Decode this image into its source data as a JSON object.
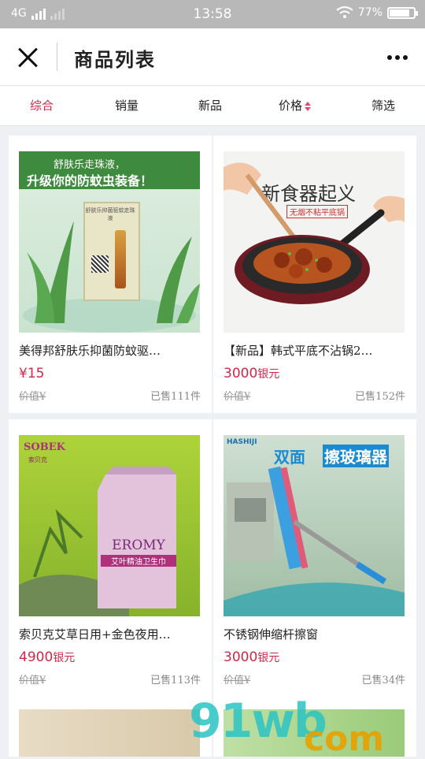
{
  "status_bar": {
    "network": "4G",
    "time": "13:58",
    "battery": "77%",
    "battery_level": 0.77
  },
  "header": {
    "title": "商品列表"
  },
  "tabs": [
    {
      "label": "综合",
      "active": true
    },
    {
      "label": "销量"
    },
    {
      "label": "新品"
    },
    {
      "label": "价格"
    },
    {
      "label": "筛选"
    }
  ],
  "products": [
    {
      "name": "美得邦舒肤乐抑菌防蚊驱…",
      "price": "¥15",
      "price_unit": "",
      "original": "价值¥",
      "sold": "已售111件",
      "image_text": {
        "top": "舒肤乐走珠液，",
        "bottom": "升级你的防蚊虫装备！",
        "product": "舒肤乐抑菌驱蚊走珠液"
      }
    },
    {
      "name": "【新品】韩式平底不沾锅2…",
      "price": "3000",
      "price_unit": "银元",
      "original": "价值¥",
      "sold": "已售152件",
      "image_text": {
        "title": "新食器起义",
        "tag": "无烟不粘平底锅"
      }
    },
    {
      "name": "索贝克艾草日用+金色夜用…",
      "price": "4900",
      "price_unit": "银元",
      "original": "价值¥",
      "sold": "已售113件",
      "image_text": {
        "brand": "SOBEK",
        "brand_cn": "索贝克",
        "product": "EROMY",
        "product_cn": "艾叶精油卫生巾"
      }
    },
    {
      "name": "不锈钢伸缩杆擦窗",
      "price": "3000",
      "price_unit": "银元",
      "original": "价值¥",
      "sold": "已售34件",
      "image_text": {
        "brand": "HASHIJI",
        "title1": "双面",
        "title2": "擦玻璃器"
      }
    }
  ],
  "watermark": {
    "text1": "91wb",
    "text2": "com"
  },
  "colors": {
    "accent": "#d0284a",
    "teal": "#2bc4c4"
  }
}
